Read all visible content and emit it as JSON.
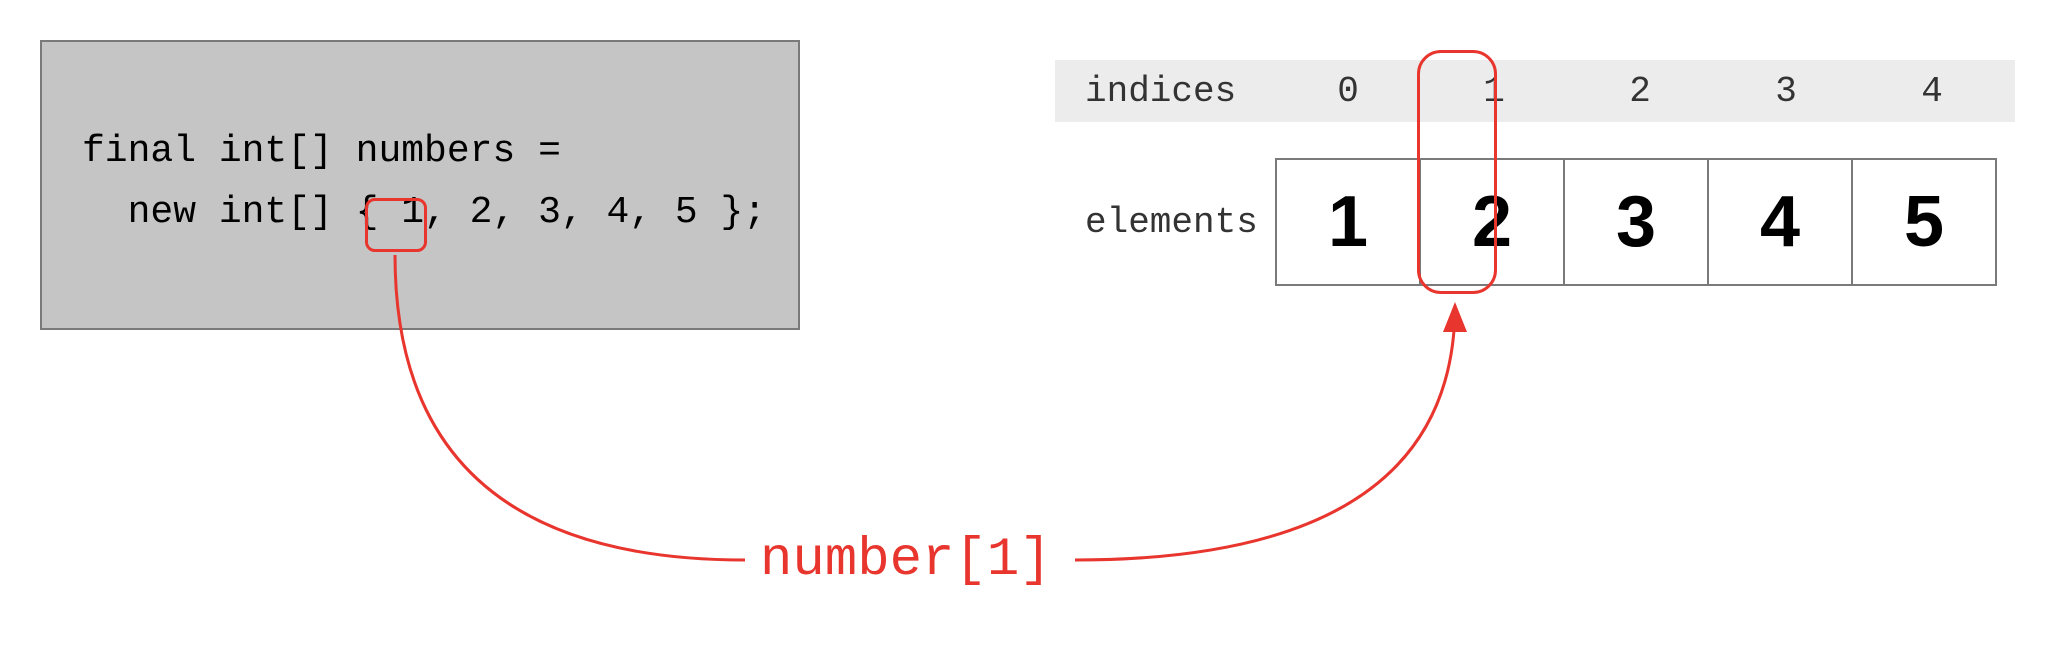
{
  "code": {
    "line1": "final int[] numbers =",
    "line2": "  new int[] { 1, 2, 3, 4, 5 };"
  },
  "table": {
    "indices_label": "indices",
    "indices": [
      "0",
      "1",
      "2",
      "3",
      "4"
    ],
    "elements_label": "elements",
    "elements": [
      "1",
      "2",
      "3",
      "4",
      "5"
    ]
  },
  "annotation": "number[1]",
  "highlight": {
    "code_value": "2",
    "array_index": 1
  }
}
